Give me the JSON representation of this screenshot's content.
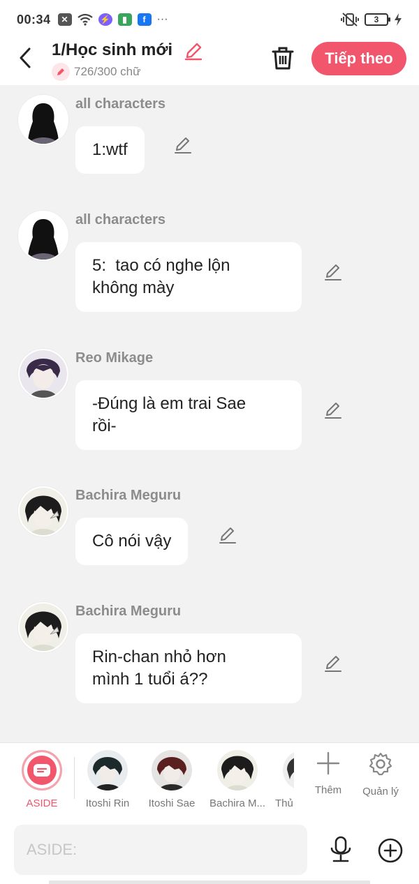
{
  "status_bar": {
    "time": "00:34",
    "battery": "3"
  },
  "header": {
    "title": "1/Học sinh mới",
    "counter": "726/300 chữ",
    "next_button": "Tiếp theo"
  },
  "messages": [
    {
      "sender": "all characters",
      "text": "1:wtf",
      "avatar": "silhouette"
    },
    {
      "sender": "all characters",
      "text": "5:  tao có nghe lộn\nkhông mày",
      "avatar": "silhouette"
    },
    {
      "sender": "Reo Mikage",
      "text": "-Đúng là em trai Sae\nrồi-",
      "avatar": "character"
    },
    {
      "sender": "Bachira Meguru",
      "text": "Cô nói vậy",
      "avatar": "character"
    },
    {
      "sender": "Bachira Meguru",
      "text": "Rin-chan nhỏ hơn\nmình 1 tuổi á??",
      "avatar": "character"
    }
  ],
  "character_bar": {
    "items": [
      {
        "label": "ASIDE",
        "selected": true
      },
      {
        "label": "Itoshi Rin"
      },
      {
        "label": "Itoshi Sae"
      },
      {
        "label": "Bachira M..."
      },
      {
        "label": "Thủ"
      }
    ],
    "add_label": "Thêm",
    "manage_label": "Quản lý"
  },
  "input": {
    "placeholder": "ASIDE:"
  },
  "colors": {
    "accent": "#f2566d",
    "background": "#f2f2f2",
    "bubble": "#ffffff"
  }
}
